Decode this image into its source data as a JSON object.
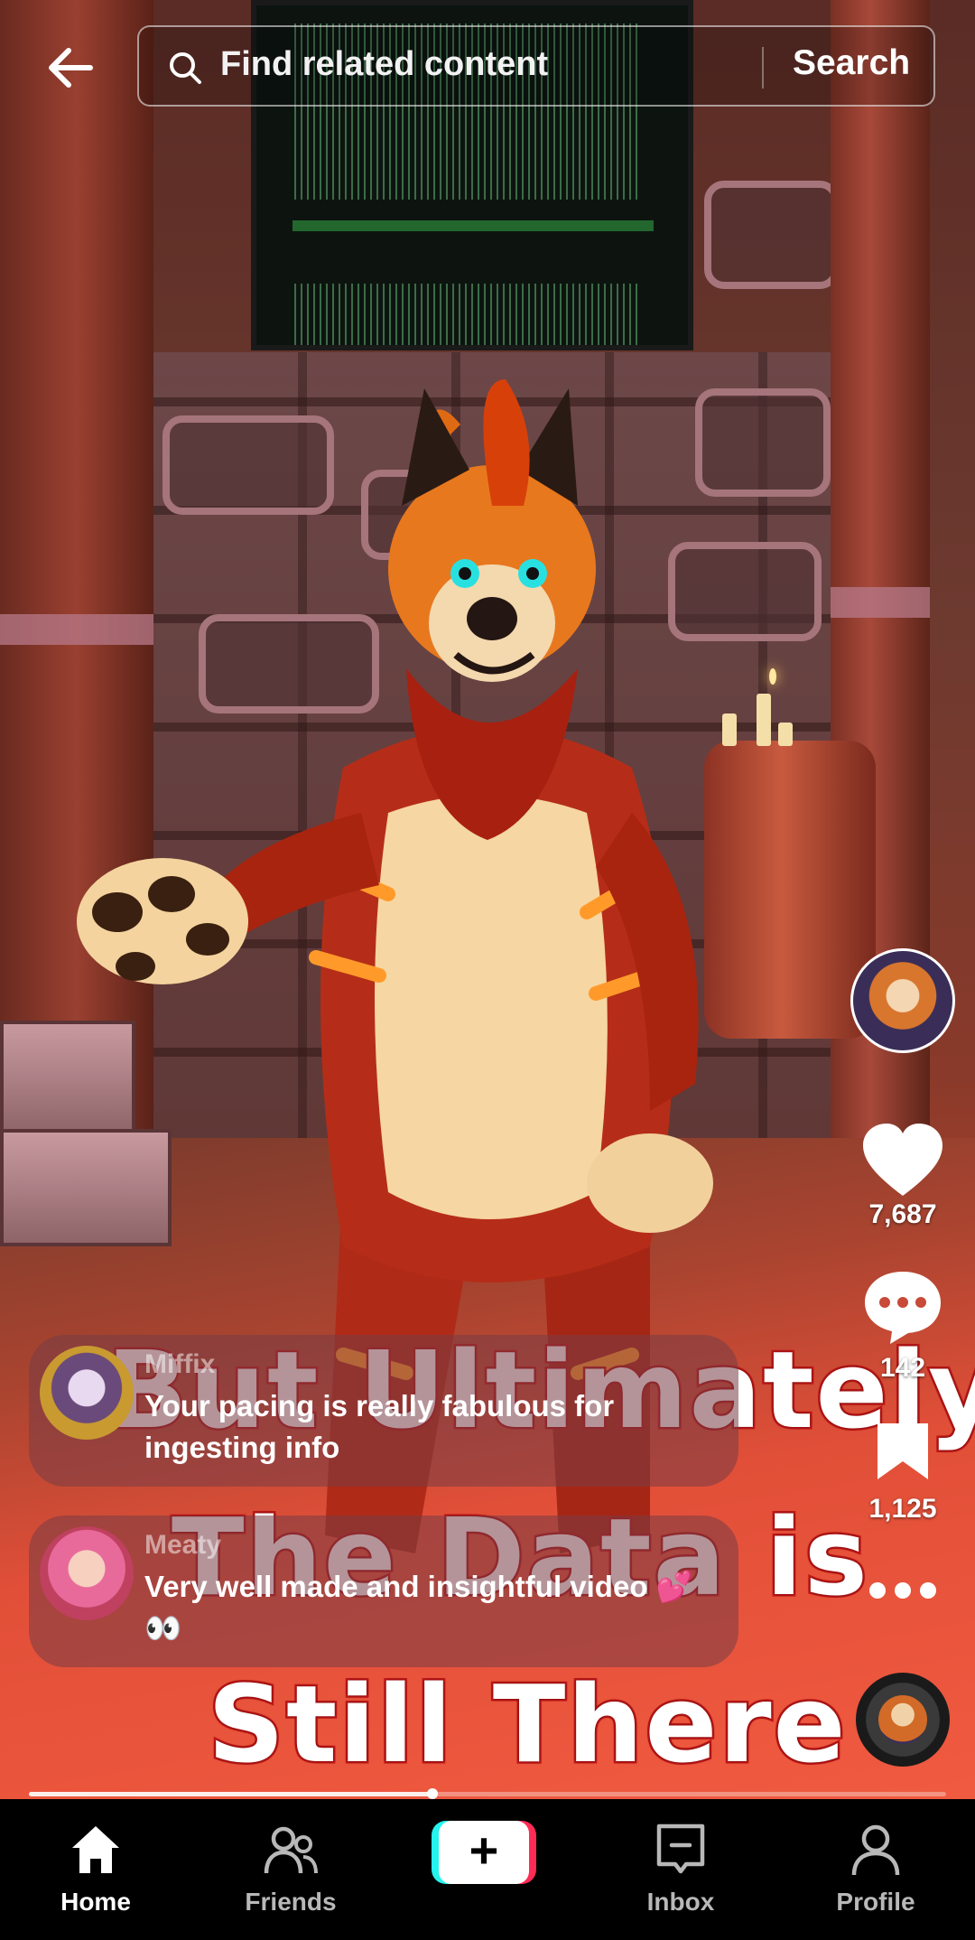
{
  "search": {
    "placeholder": "Find related content",
    "button_label": "Search"
  },
  "video": {
    "caption_lines": [
      "But Ultimately",
      "The Data is",
      "Still There"
    ],
    "progress": 0.44
  },
  "actions": {
    "likes": "7,687",
    "comments": "142",
    "saves": "1,125"
  },
  "comments": [
    {
      "user": "Miffix",
      "text": "Your pacing is really fabulous for ingesting info"
    },
    {
      "user": "Meaty",
      "text": "Very well made and insightful video 💕👀"
    }
  ],
  "nav": {
    "items": [
      {
        "label": "Home",
        "icon": "home-icon",
        "active": true
      },
      {
        "label": "Friends",
        "icon": "friends-icon",
        "active": false
      },
      {
        "label": "",
        "icon": "create-icon",
        "active": false
      },
      {
        "label": "Inbox",
        "icon": "inbox-icon",
        "active": false
      },
      {
        "label": "Profile",
        "icon": "profile-icon",
        "active": false
      }
    ]
  },
  "colors": {
    "caption_stroke": "#c01818",
    "create_cyan": "#25f4ee",
    "create_pink": "#fe2c55",
    "nav_background": "#000000"
  }
}
